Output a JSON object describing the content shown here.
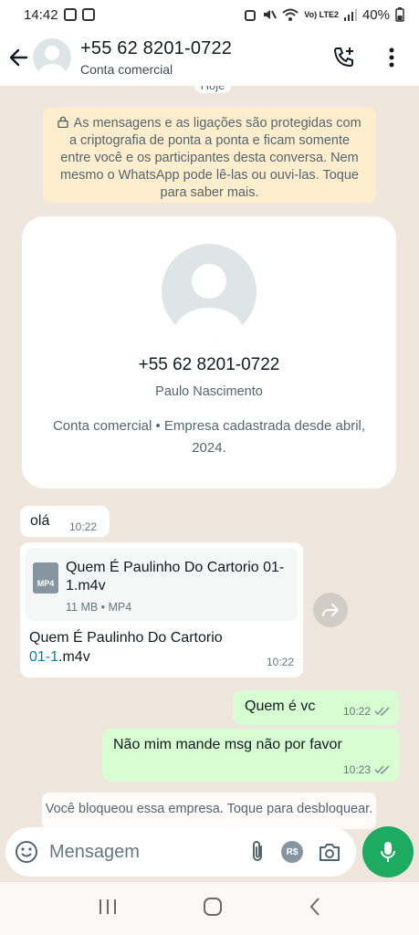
{
  "status_bar": {
    "time": "14:42",
    "battery": "40%",
    "network": "Vo) LTE2"
  },
  "header": {
    "title": "+55 62 8201-0722",
    "subtitle": "Conta comercial"
  },
  "chat": {
    "date_chip": "Hoje",
    "encryption_notice": "As mensagens e as ligações são protegidas com a criptografia de ponta a ponta e ficam somente entre você e os participantes desta conversa. Nem mesmo o WhatsApp pode lê-las ou ouvi-las. Toque para saber mais.",
    "contact_card": {
      "phone": "+55 62 8201-0722",
      "name": "Paulo Nascimento",
      "description": "Conta comercial • Empresa cadastrada desde abril, 2024."
    },
    "messages": [
      {
        "text": "olá",
        "time": "10:22"
      },
      {
        "doc_title": "Quem É Paulinho Do Cartorio 01-1.m4v",
        "doc_meta": "11 MB • MP4",
        "doc_type": "MP4",
        "caption_prefix": "Quem É Paulinho Do Cartorio",
        "caption_link": "01-1",
        "caption_suffix": ".m4v",
        "time": "10:22"
      },
      {
        "text": "Quem é vc",
        "time": "10:22"
      },
      {
        "text": "Não mim mande msg não por favor",
        "time": "10:23"
      }
    ],
    "blocked_notice": "Você bloqueou essa empresa. Toque para desbloquear."
  },
  "composer": {
    "placeholder": "Mensagem",
    "currency_label": "R$"
  },
  "colors": {
    "accent": "#1daa61",
    "outgoing_bubble": "#d9fdd3",
    "incoming_bubble": "#ffffff",
    "chat_bg": "#efe7dd",
    "ticks": "#8696a0"
  }
}
